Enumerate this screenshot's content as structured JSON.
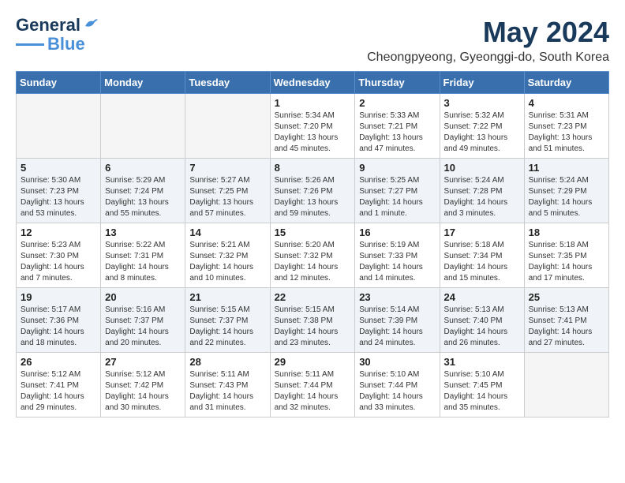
{
  "header": {
    "logo_line1": "General",
    "logo_line2": "Blue",
    "month": "May 2024",
    "location": "Cheongpyeong, Gyeonggi-do, South Korea"
  },
  "weekdays": [
    "Sunday",
    "Monday",
    "Tuesday",
    "Wednesday",
    "Thursday",
    "Friday",
    "Saturday"
  ],
  "weeks": [
    [
      {
        "day": "",
        "info": ""
      },
      {
        "day": "",
        "info": ""
      },
      {
        "day": "",
        "info": ""
      },
      {
        "day": "1",
        "info": "Sunrise: 5:34 AM\nSunset: 7:20 PM\nDaylight: 13 hours\nand 45 minutes."
      },
      {
        "day": "2",
        "info": "Sunrise: 5:33 AM\nSunset: 7:21 PM\nDaylight: 13 hours\nand 47 minutes."
      },
      {
        "day": "3",
        "info": "Sunrise: 5:32 AM\nSunset: 7:22 PM\nDaylight: 13 hours\nand 49 minutes."
      },
      {
        "day": "4",
        "info": "Sunrise: 5:31 AM\nSunset: 7:23 PM\nDaylight: 13 hours\nand 51 minutes."
      }
    ],
    [
      {
        "day": "5",
        "info": "Sunrise: 5:30 AM\nSunset: 7:23 PM\nDaylight: 13 hours\nand 53 minutes."
      },
      {
        "day": "6",
        "info": "Sunrise: 5:29 AM\nSunset: 7:24 PM\nDaylight: 13 hours\nand 55 minutes."
      },
      {
        "day": "7",
        "info": "Sunrise: 5:27 AM\nSunset: 7:25 PM\nDaylight: 13 hours\nand 57 minutes."
      },
      {
        "day": "8",
        "info": "Sunrise: 5:26 AM\nSunset: 7:26 PM\nDaylight: 13 hours\nand 59 minutes."
      },
      {
        "day": "9",
        "info": "Sunrise: 5:25 AM\nSunset: 7:27 PM\nDaylight: 14 hours\nand 1 minute."
      },
      {
        "day": "10",
        "info": "Sunrise: 5:24 AM\nSunset: 7:28 PM\nDaylight: 14 hours\nand 3 minutes."
      },
      {
        "day": "11",
        "info": "Sunrise: 5:24 AM\nSunset: 7:29 PM\nDaylight: 14 hours\nand 5 minutes."
      }
    ],
    [
      {
        "day": "12",
        "info": "Sunrise: 5:23 AM\nSunset: 7:30 PM\nDaylight: 14 hours\nand 7 minutes."
      },
      {
        "day": "13",
        "info": "Sunrise: 5:22 AM\nSunset: 7:31 PM\nDaylight: 14 hours\nand 8 minutes."
      },
      {
        "day": "14",
        "info": "Sunrise: 5:21 AM\nSunset: 7:32 PM\nDaylight: 14 hours\nand 10 minutes."
      },
      {
        "day": "15",
        "info": "Sunrise: 5:20 AM\nSunset: 7:32 PM\nDaylight: 14 hours\nand 12 minutes."
      },
      {
        "day": "16",
        "info": "Sunrise: 5:19 AM\nSunset: 7:33 PM\nDaylight: 14 hours\nand 14 minutes."
      },
      {
        "day": "17",
        "info": "Sunrise: 5:18 AM\nSunset: 7:34 PM\nDaylight: 14 hours\nand 15 minutes."
      },
      {
        "day": "18",
        "info": "Sunrise: 5:18 AM\nSunset: 7:35 PM\nDaylight: 14 hours\nand 17 minutes."
      }
    ],
    [
      {
        "day": "19",
        "info": "Sunrise: 5:17 AM\nSunset: 7:36 PM\nDaylight: 14 hours\nand 18 minutes."
      },
      {
        "day": "20",
        "info": "Sunrise: 5:16 AM\nSunset: 7:37 PM\nDaylight: 14 hours\nand 20 minutes."
      },
      {
        "day": "21",
        "info": "Sunrise: 5:15 AM\nSunset: 7:37 PM\nDaylight: 14 hours\nand 22 minutes."
      },
      {
        "day": "22",
        "info": "Sunrise: 5:15 AM\nSunset: 7:38 PM\nDaylight: 14 hours\nand 23 minutes."
      },
      {
        "day": "23",
        "info": "Sunrise: 5:14 AM\nSunset: 7:39 PM\nDaylight: 14 hours\nand 24 minutes."
      },
      {
        "day": "24",
        "info": "Sunrise: 5:13 AM\nSunset: 7:40 PM\nDaylight: 14 hours\nand 26 minutes."
      },
      {
        "day": "25",
        "info": "Sunrise: 5:13 AM\nSunset: 7:41 PM\nDaylight: 14 hours\nand 27 minutes."
      }
    ],
    [
      {
        "day": "26",
        "info": "Sunrise: 5:12 AM\nSunset: 7:41 PM\nDaylight: 14 hours\nand 29 minutes."
      },
      {
        "day": "27",
        "info": "Sunrise: 5:12 AM\nSunset: 7:42 PM\nDaylight: 14 hours\nand 30 minutes."
      },
      {
        "day": "28",
        "info": "Sunrise: 5:11 AM\nSunset: 7:43 PM\nDaylight: 14 hours\nand 31 minutes."
      },
      {
        "day": "29",
        "info": "Sunrise: 5:11 AM\nSunset: 7:44 PM\nDaylight: 14 hours\nand 32 minutes."
      },
      {
        "day": "30",
        "info": "Sunrise: 5:10 AM\nSunset: 7:44 PM\nDaylight: 14 hours\nand 33 minutes."
      },
      {
        "day": "31",
        "info": "Sunrise: 5:10 AM\nSunset: 7:45 PM\nDaylight: 14 hours\nand 35 minutes."
      },
      {
        "day": "",
        "info": ""
      }
    ]
  ]
}
